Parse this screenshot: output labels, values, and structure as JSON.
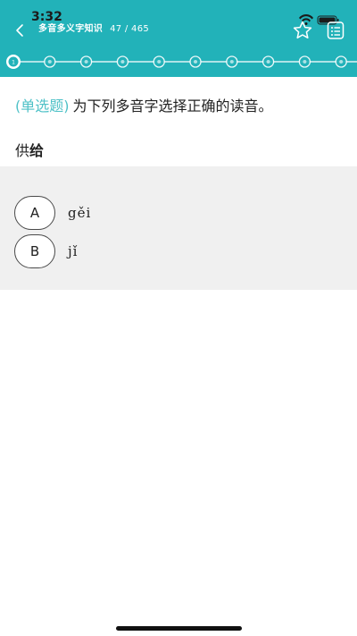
{
  "status_bar": {
    "time": "3:32"
  },
  "nav": {
    "title": "多音多义字知识",
    "counter": "47 / 465",
    "back_icon": "chevron-left-icon",
    "star_icon": "star-outline-icon",
    "sheet_icon": "answer-sheet-icon"
  },
  "progress": {
    "current_label": "1",
    "step_count_visible": 10
  },
  "question": {
    "type_label": "(单选题)",
    "stem": "为下列多音字选择正确的读音。",
    "word_prefix": "供",
    "word_highlight": "给"
  },
  "options": [
    {
      "letter": "A",
      "text": "gěi"
    },
    {
      "letter": "B",
      "text": "jǐ"
    }
  ],
  "colors": {
    "primary": "#22b2b9",
    "accent_text": "#4ec1c7",
    "options_bg": "#f0f0f0"
  }
}
